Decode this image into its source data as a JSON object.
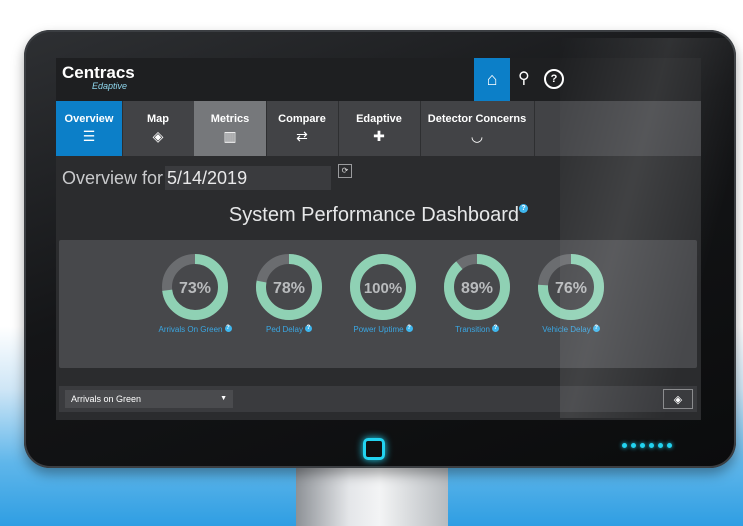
{
  "app": {
    "brand": "Centracs",
    "brand_sub": "Edaptive"
  },
  "topbar": {
    "icons": [
      {
        "name": "home-icon",
        "glyph": "⌂",
        "active": true
      },
      {
        "name": "sitemap-icon",
        "glyph": "⚲"
      },
      {
        "name": "help-circle-icon",
        "glyph": "?"
      }
    ]
  },
  "nav": {
    "tabs": [
      {
        "label": "Overview",
        "icon": "list-icon",
        "glyph": "☰",
        "state": "active"
      },
      {
        "label": "Map",
        "icon": "map-pin-icon",
        "glyph": "◈",
        "state": ""
      },
      {
        "label": "Metrics",
        "icon": "bar-chart-icon",
        "glyph": "▥",
        "state": "selected"
      },
      {
        "label": "Compare",
        "icon": "compare-arrows-icon",
        "glyph": "⇄",
        "state": ""
      },
      {
        "label": "Edaptive",
        "icon": "plus-icon",
        "glyph": "✚",
        "state": ""
      },
      {
        "label": "Detector Concerns",
        "icon": "detector-icon",
        "glyph": "◡",
        "state": ""
      }
    ]
  },
  "overview": {
    "label": "Overview for",
    "date": "5/14/2019",
    "refresh_icon": "refresh-icon"
  },
  "dashboard": {
    "title": "System Performance Dashboard",
    "gauges": [
      {
        "value": "73%",
        "percent": 73,
        "caption": "Arrivals On Green"
      },
      {
        "value": "78%",
        "percent": 78,
        "caption": "Ped Delay"
      },
      {
        "value": "100%",
        "percent": 100,
        "caption": "Power Uptime"
      },
      {
        "value": "89%",
        "percent": 89,
        "caption": "Transition"
      },
      {
        "value": "76%",
        "percent": 76,
        "caption": "Vehicle Delay"
      }
    ]
  },
  "bottom": {
    "select_value": "Arrivals on Green",
    "map_button_icon": "map-pin-icon"
  },
  "colors": {
    "accent": "#0c7fc8",
    "gauge_fill": "#8fd1b4",
    "gauge_track": "#6b6d70",
    "caption": "#3aa7e3",
    "glow": "#22d3f0"
  }
}
